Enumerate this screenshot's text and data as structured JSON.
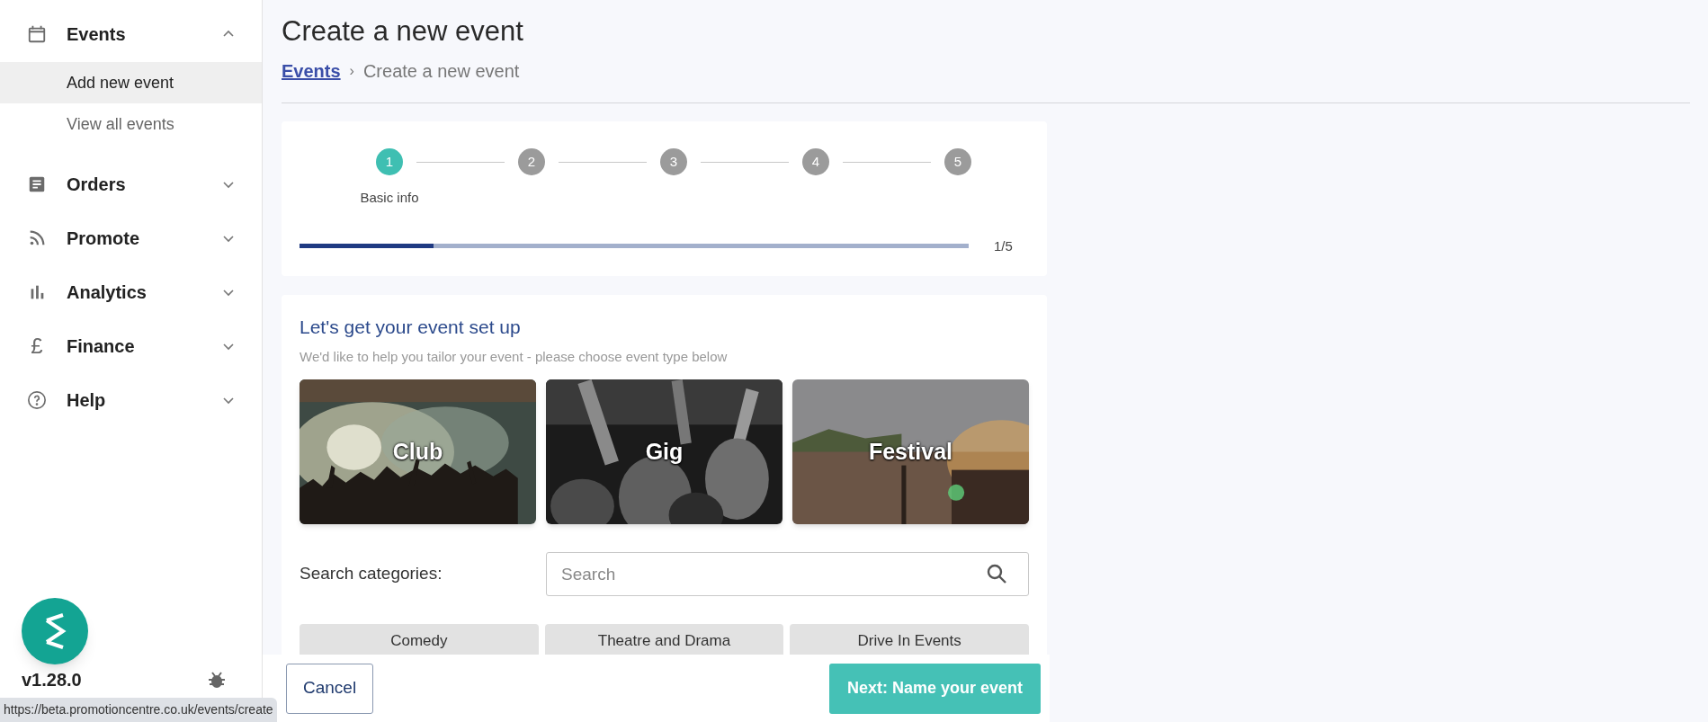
{
  "sidebar": {
    "items": [
      {
        "label": "Events",
        "expanded": true,
        "children": [
          {
            "label": "Add new event",
            "selected": true
          },
          {
            "label": "View all events",
            "selected": false
          }
        ]
      },
      {
        "label": "Orders",
        "expanded": false
      },
      {
        "label": "Promote",
        "expanded": false
      },
      {
        "label": "Analytics",
        "expanded": false
      },
      {
        "label": "Finance",
        "expanded": false,
        "icon_text": "£"
      },
      {
        "label": "Help",
        "expanded": false
      }
    ],
    "version": "v1.28.0"
  },
  "page": {
    "title": "Create a new event",
    "breadcrumb": [
      {
        "label": "Events",
        "kind": "link"
      },
      {
        "label": "›",
        "kind": "separator"
      },
      {
        "label": "Create a new event",
        "kind": "current"
      }
    ]
  },
  "stepper": {
    "steps": [
      {
        "number": "1",
        "label": "Basic info",
        "selected": true
      },
      {
        "number": "2",
        "selected": false
      },
      {
        "number": "3",
        "selected": false
      },
      {
        "number": "4",
        "selected": false
      },
      {
        "number": "5",
        "selected": false
      }
    ],
    "progress": {
      "level": 0.2,
      "reading": "1/5"
    }
  },
  "setup": {
    "heading": "Let's get your event set up",
    "subtitle": "We'd like to help you tailor your event - please choose event type below",
    "event_types": [
      {
        "label": "Club",
        "kind": "picture"
      },
      {
        "label": "Gig",
        "kind": "picture"
      },
      {
        "label": "Festival",
        "kind": "picture"
      }
    ],
    "search": {
      "label": "Search categories:",
      "placeholder": "Search"
    },
    "categories": [
      "Comedy",
      "Theatre and Drama",
      "Drive In Events"
    ]
  },
  "footer": {
    "buttons": [
      {
        "label": "Cancel",
        "kind": "secondary"
      },
      {
        "label": "Next: Name your event",
        "kind": "primary"
      }
    ]
  },
  "status_bar": {
    "url": "https://beta.promotioncentre.co.uk/events/create"
  }
}
